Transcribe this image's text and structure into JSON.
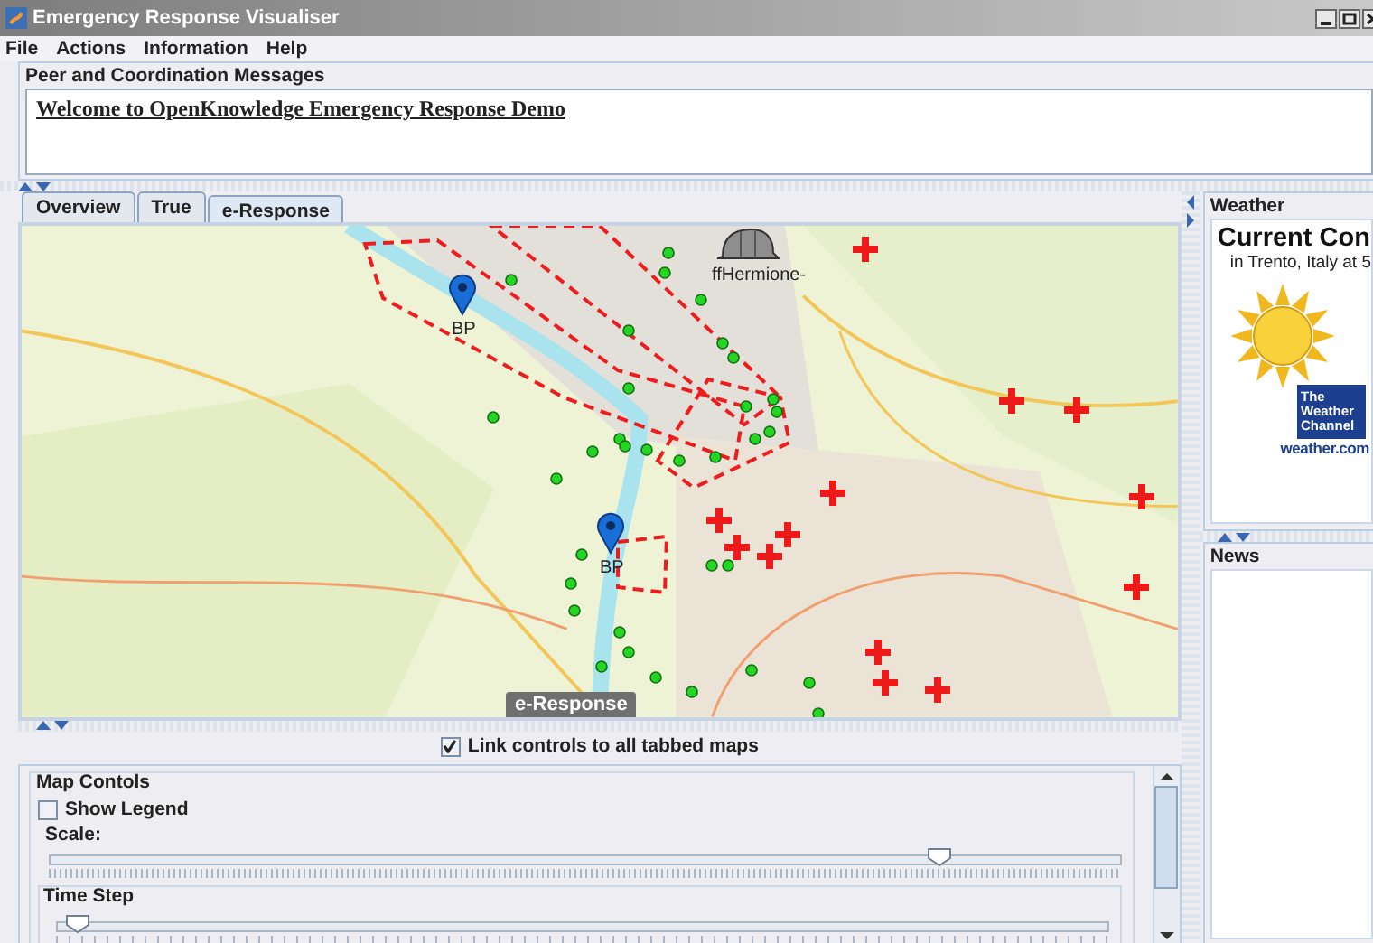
{
  "window": {
    "title": "Emergency Response Visualiser"
  },
  "menu": [
    {
      "label": "File"
    },
    {
      "label": "Actions"
    },
    {
      "label": "Information"
    },
    {
      "label": "Help"
    }
  ],
  "messages": {
    "title": "Peer and Coordination Messages",
    "lines": [
      "Welcome to OpenKnowledge Emergency Response Demo"
    ]
  },
  "tabs": [
    {
      "label": "Overview",
      "selected": false
    },
    {
      "label": "True",
      "selected": false
    },
    {
      "label": "e-Response",
      "selected": true
    }
  ],
  "map": {
    "kind": "picture",
    "markers": [
      {
        "kind": "pin",
        "label": "BP"
      },
      {
        "kind": "pin",
        "label": "BP"
      },
      {
        "kind": "helmet",
        "label": "ffHermione-"
      }
    ],
    "overlay_label": "e-Response"
  },
  "link_controls": {
    "label": "Link controls to all tabbed maps",
    "checked": true
  },
  "map_controls": {
    "title": "Map Contols",
    "show_legend": {
      "label": "Show Legend",
      "checked": false
    },
    "scale": {
      "label": "Scale:",
      "level": 0.83
    },
    "time_step": {
      "title": "Time Step",
      "level": 0.02
    }
  },
  "weather": {
    "title": "Weather",
    "heading": "Current Con",
    "subtitle": "in Trento, Italy at 5",
    "logo": "The Weather Channel",
    "link": "weather.com"
  },
  "news": {
    "title": "News"
  }
}
